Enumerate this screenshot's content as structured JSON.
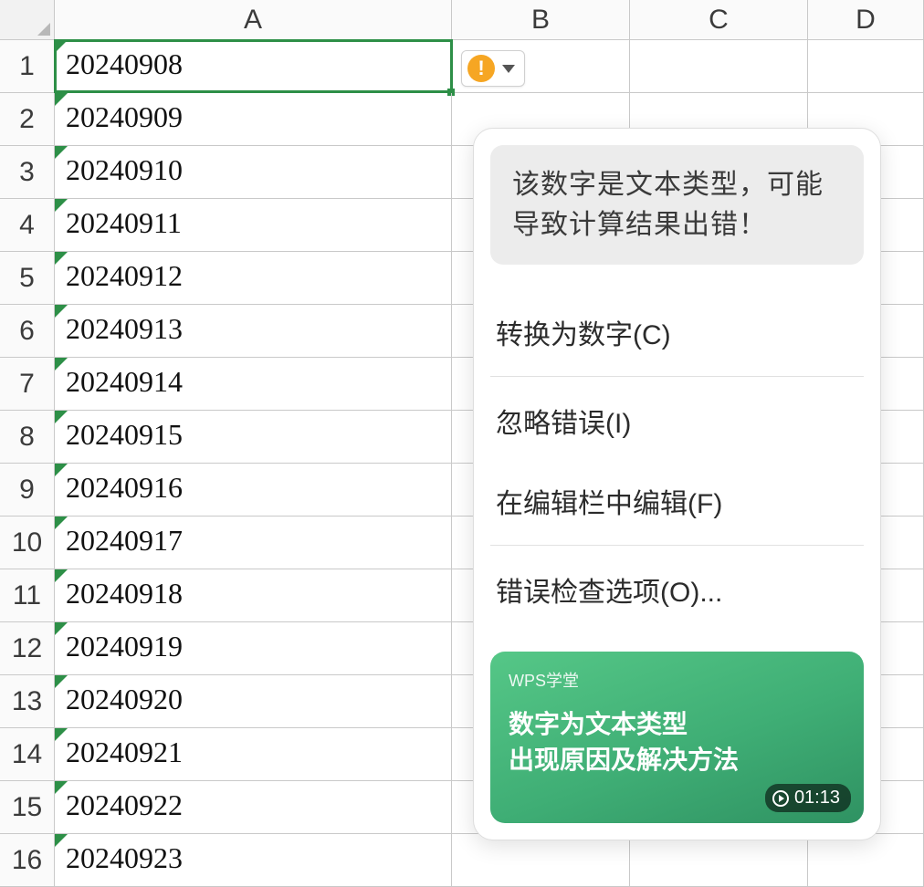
{
  "columns": {
    "A": "A",
    "B": "B",
    "C": "C",
    "D": "D"
  },
  "rows": [
    {
      "num": "1",
      "A": "20240908"
    },
    {
      "num": "2",
      "A": "20240909"
    },
    {
      "num": "3",
      "A": "20240910"
    },
    {
      "num": "4",
      "A": "20240911"
    },
    {
      "num": "5",
      "A": "20240912"
    },
    {
      "num": "6",
      "A": "20240913"
    },
    {
      "num": "7",
      "A": "20240914"
    },
    {
      "num": "8",
      "A": "20240915"
    },
    {
      "num": "9",
      "A": "20240916"
    },
    {
      "num": "10",
      "A": "20240917"
    },
    {
      "num": "11",
      "A": "20240918"
    },
    {
      "num": "12",
      "A": "20240919"
    },
    {
      "num": "13",
      "A": "20240920"
    },
    {
      "num": "14",
      "A": "20240921"
    },
    {
      "num": "15",
      "A": "20240922"
    },
    {
      "num": "16",
      "A": "20240923"
    }
  ],
  "error_button": {
    "badge": "!",
    "caret": "▾"
  },
  "menu": {
    "tip": "该数字是文本类型，可能导致计算结果出错！",
    "items": {
      "convert": "转换为数字(C)",
      "ignore": "忽略错误(I)",
      "edit": "在编辑栏中编辑(F)",
      "options": "错误检查选项(O)..."
    },
    "video": {
      "brand": "WPS学堂",
      "title_line1": "数字为文本类型",
      "title_line2": "出现原因及解决方法",
      "duration": "01:13"
    }
  }
}
